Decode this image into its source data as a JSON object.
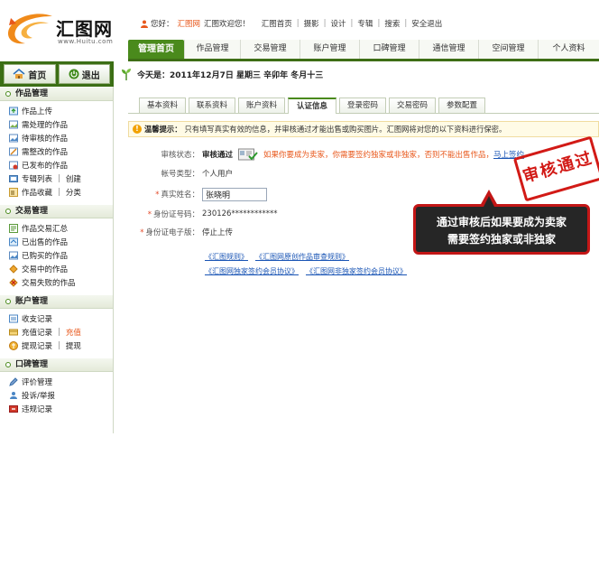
{
  "brand": {
    "name": "汇图网",
    "url": "www.Huitu.com"
  },
  "topbar": {
    "greeting": "您好：",
    "username": "汇图网",
    "welcome": "汇图欢迎您！",
    "links": [
      "汇图首页",
      "摄影",
      "设计",
      "专辑",
      "搜索",
      "安全退出"
    ]
  },
  "mainnav": {
    "items": [
      "管理首页",
      "作品管理",
      "交易管理",
      "账户管理",
      "口碑管理",
      "通信管理",
      "空间管理",
      "个人资料"
    ]
  },
  "leftbuttons": {
    "home": "首页",
    "logout": "退出"
  },
  "date": "今天是：2011年12月7日  星期三  辛卯年  冬月十三",
  "sidebar": {
    "sections": [
      {
        "title": "作品管理",
        "items": [
          {
            "label": "作品上传"
          },
          {
            "label": "需处理的作品"
          },
          {
            "label": "待审核的作品"
          },
          {
            "label": "需整改的作品"
          },
          {
            "label": "已发布的作品"
          },
          {
            "label": "专辑列表",
            "extra": "创建"
          },
          {
            "label": "作品收藏",
            "extra": "分类"
          }
        ]
      },
      {
        "title": "交易管理",
        "items": [
          {
            "label": "作品交易汇总"
          },
          {
            "label": "已出售的作品"
          },
          {
            "label": "已购买的作品"
          },
          {
            "label": "交易中的作品"
          },
          {
            "label": "交易失败的作品"
          }
        ]
      },
      {
        "title": "账户管理",
        "items": [
          {
            "label": "收支记录"
          },
          {
            "label": "充值记录",
            "extra": "充值"
          },
          {
            "label": "提现记录",
            "extra": "提现"
          }
        ]
      },
      {
        "title": "口碑管理",
        "items": [
          {
            "label": "评价管理"
          },
          {
            "label": "投诉/举报"
          },
          {
            "label": "违规记录"
          }
        ]
      }
    ]
  },
  "tabs": [
    "基本资料",
    "联系资料",
    "账户资料",
    "认证信息",
    "登录密码",
    "交易密码",
    "参数配置"
  ],
  "notice": {
    "label": "温馨提示：",
    "text": "只有填写真实有效的信息，并审核通过才能出售或购买图片。汇图网将对您的以下资料进行保密。"
  },
  "form": {
    "review_status_label": "审核状态：",
    "review_status_value": "审核通过",
    "review_note": "如果你要成为卖家，你需要签约独家或非独家，否则不能出售作品，",
    "sign_link": "马上签约",
    "sign_link_end": "。",
    "account_type_label": "帐号类型：",
    "account_type_value": "个人用户",
    "real_name_label": "真实姓名：",
    "real_name_value": "张晓明",
    "id_number_label": "身份证号码：",
    "id_number_value": "230126************",
    "id_scan_label": "身份证电子版：",
    "id_scan_value": "停止上传"
  },
  "links": {
    "row1": [
      "《汇图规则》",
      "《汇图网原创作品审查规则》"
    ],
    "row2": [
      "《汇图网独家签约会员协议》",
      "《汇图网非独家签约会员协议》"
    ]
  },
  "stamp": "审核通过",
  "callout": {
    "line1": "通过审核后如果要成为卖家",
    "line2": "需要签约独家或非独家"
  },
  "colors": {
    "brand_green": "#4a8a1c",
    "dark_green": "#3b6e14",
    "accent_orange": "#e8581c",
    "link_blue": "#1a55b5",
    "stamp_red": "#d21a16"
  }
}
